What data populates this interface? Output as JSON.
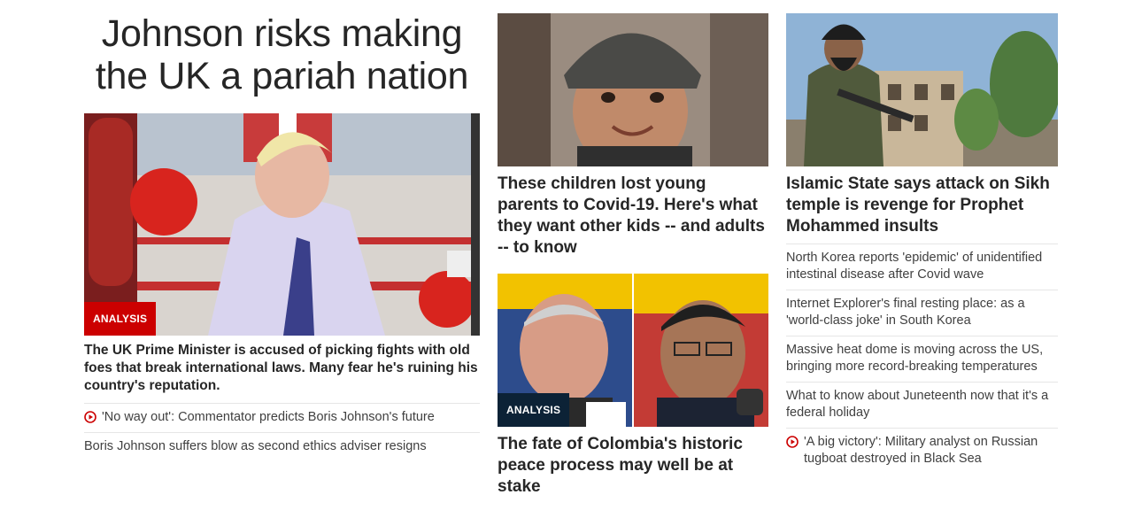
{
  "lead_story": {
    "headline": "Johnson risks making the UK a pariah nation",
    "badge": "ANALYSIS",
    "summary": "The UK Prime Minister is accused of picking fights with old foes that break international laws. Many fear he's ruining his country's reputation.",
    "links": [
      {
        "text": "'No way out': Commentator predicts Boris Johnson's future",
        "video": true
      },
      {
        "text": "Boris Johnson suffers blow as second ethics adviser resigns",
        "video": false
      }
    ]
  },
  "middle": {
    "story1": {
      "title": "These children lost young parents to Covid-19. Here's what they want other kids -- and adults -- to know"
    },
    "story2": {
      "badge": "ANALYSIS",
      "title": "The fate of Colombia's historic peace process may well be at stake"
    }
  },
  "right": {
    "story": {
      "title": "Islamic State says attack on Sikh temple is revenge for Prophet Mohammed insults"
    },
    "links": [
      {
        "text": "North Korea reports 'epidemic' of unidentified intestinal disease after Covid wave",
        "video": false
      },
      {
        "text": "Internet Explorer's final resting place: as a 'world-class joke' in South Korea",
        "video": false
      },
      {
        "text": "Massive heat dome is moving across the US, bringing more record-breaking temperatures",
        "video": false
      },
      {
        "text": "What to know about Juneteenth now that it's a federal holiday",
        "video": false
      },
      {
        "text": "'A big victory': Military analyst on Russian tugboat destroyed in Black Sea",
        "video": true
      }
    ]
  },
  "colors": {
    "badge_red": "#cc0000",
    "badge_dark": "#0c2236",
    "play_icon": "#cc0000"
  }
}
